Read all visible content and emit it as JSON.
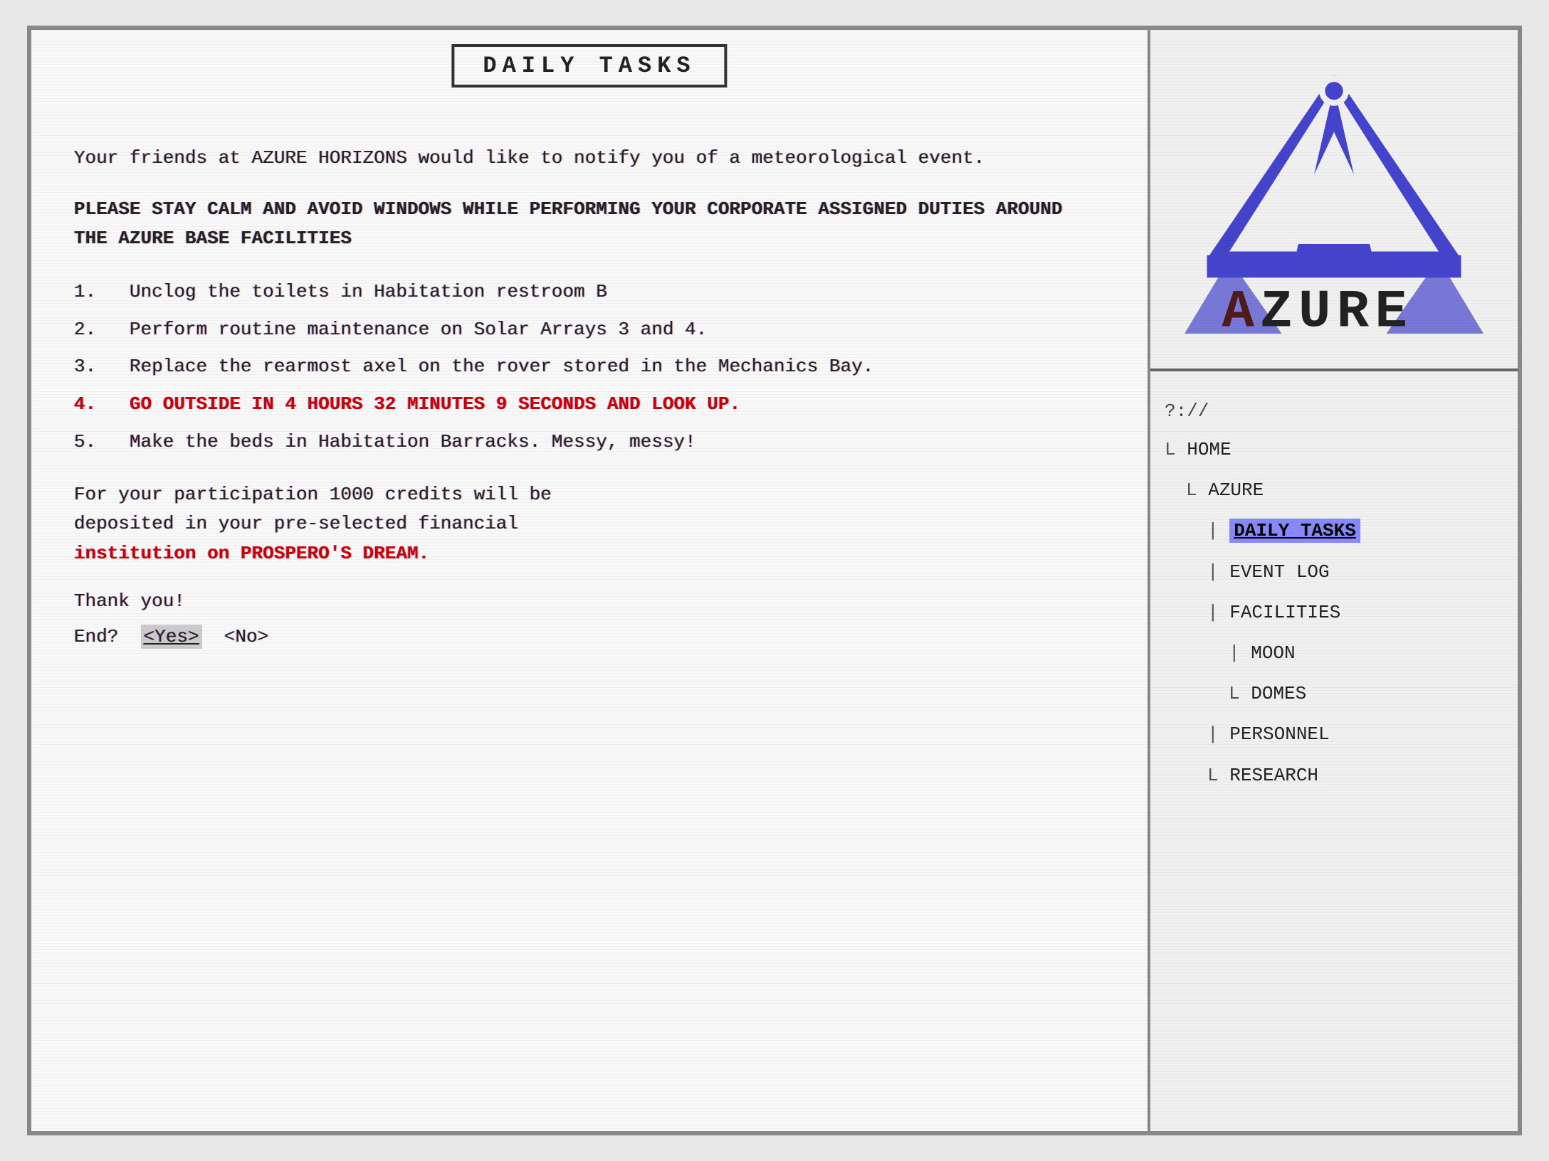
{
  "title": {
    "label": "DAILY   TASKS"
  },
  "main": {
    "intro": "Your friends at AZURE HORIZONS would like to notify you of a meteorological event.",
    "warning": "PLEASE STAY CALM AND AVOID WINDOWS WHILE PERFORMING YOUR CORPORATE ASSIGNED DUTIES AROUND THE AZURE BASE FACILITIES",
    "tasks": [
      {
        "number": "1.",
        "text": "Unclog the toilets in Habitation restroom B",
        "highlight": false
      },
      {
        "number": "2.",
        "text": "Perform routine maintenance on Solar Arrays 3 and 4.",
        "highlight": false
      },
      {
        "number": "3.",
        "text": "Replace the rearmost axel on the rover stored in the Mechanics Bay.",
        "highlight": false
      },
      {
        "number": "4.",
        "text": "GO OUTSIDE IN 4 HOURS 32 MINUTES 9 SECONDS AND LOOK UP.",
        "highlight": true
      },
      {
        "number": "5.",
        "text": "Make the beds in Habitation Barracks. Messy, messy!",
        "highlight": false
      }
    ],
    "credits_line1": "For your participation 1000 credits will be",
    "credits_line2": "deposited in your pre-selected financial",
    "credits_line3": "institution on PROSPERO'S DREAM.",
    "thank_you": "Thank you!",
    "end_prompt": "End?",
    "yes_label": "<Yes>",
    "no_label": "<No>"
  },
  "sidebar": {
    "nav": {
      "root": "?://",
      "items": [
        {
          "label": "HOME",
          "prefix": "L",
          "level": 0,
          "active": false
        },
        {
          "label": "AZURE",
          "prefix": "L",
          "level": 1,
          "active": false
        },
        {
          "label": "DAILY TASKS",
          "prefix": "|",
          "level": 2,
          "active": true
        },
        {
          "label": "EVENT LOG",
          "prefix": "|",
          "level": 2,
          "active": false
        },
        {
          "label": "FACILITIES",
          "prefix": "|",
          "level": 2,
          "active": false
        },
        {
          "label": "MOON",
          "prefix": "|",
          "level": 3,
          "active": false
        },
        {
          "label": "DOMES",
          "prefix": "L",
          "level": 3,
          "active": false
        },
        {
          "label": "PERSONNEL",
          "prefix": "|",
          "level": 2,
          "active": false
        },
        {
          "label": "RESEARCH",
          "prefix": "L",
          "level": 2,
          "active": false
        }
      ]
    }
  }
}
